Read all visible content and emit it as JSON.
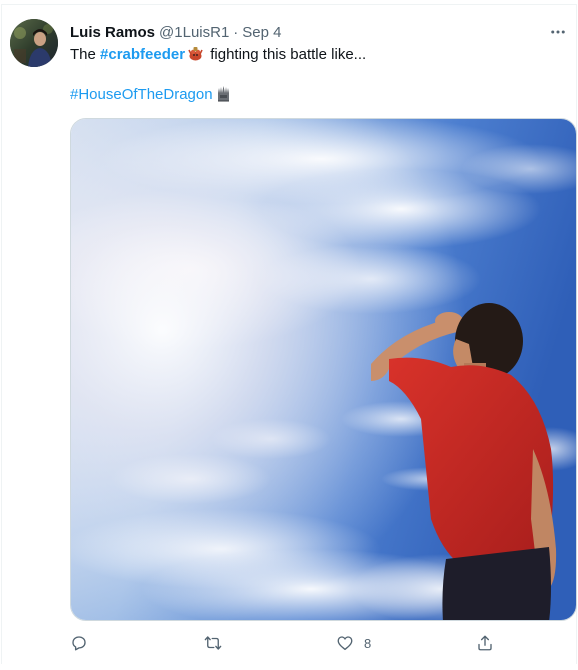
{
  "tweet": {
    "author": {
      "display_name": "Luis Ramos",
      "handle": "@1LuisR1",
      "separator": "·",
      "timestamp": "Sep 4"
    },
    "text": {
      "prefix": "The ",
      "hashtag_1": "#crabfeeder",
      "emoji_1": "crab-warrior-emoji",
      "suffix": " fighting this battle like...",
      "hashtag_2": "#HouseOfTheDragon",
      "emoji_2": "iron-throne-emoji"
    },
    "media": {
      "description_icon": "photo-boy-looking-at-sky"
    },
    "actions": {
      "reply": {
        "icon": "reply-icon",
        "count": ""
      },
      "retweet": {
        "icon": "retweet-icon",
        "count": ""
      },
      "like": {
        "icon": "heart-icon",
        "count": "8"
      },
      "share": {
        "icon": "share-icon",
        "count": ""
      }
    },
    "more_icon": "more-horizontal-icon"
  },
  "colors": {
    "link": "#1d9bf0",
    "secondary_text": "#536471",
    "primary_text": "#0f1419",
    "border": "#cfd9de"
  }
}
